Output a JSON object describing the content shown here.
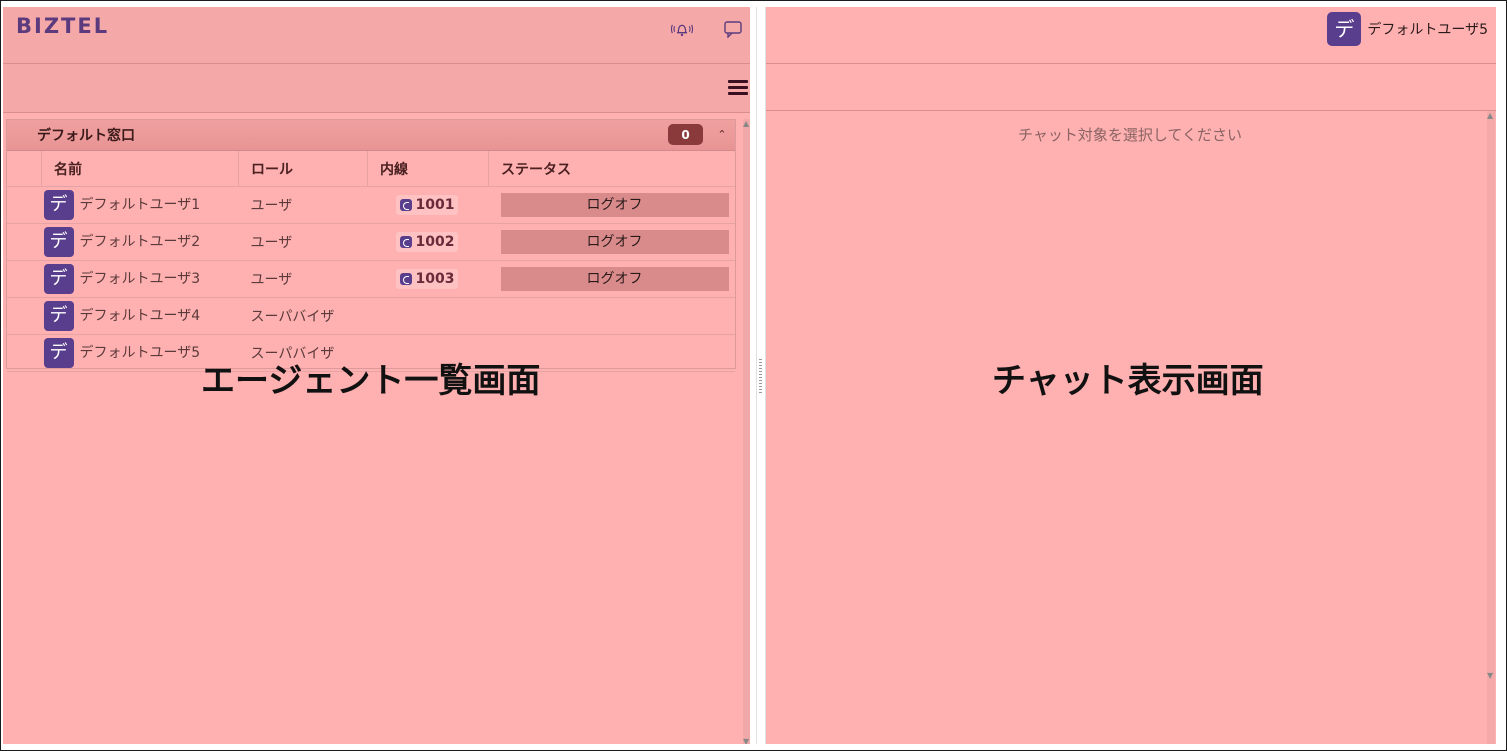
{
  "header": {
    "logo": "BIZTEL",
    "bell_icon": "bell-icon",
    "chat_icon": "chat-bubble-icon",
    "menu_icon": "hamburger-menu-icon"
  },
  "group": {
    "title": "デフォルト窓口",
    "count": "0",
    "collapse_icon": "double-chevron-up-icon",
    "columns": {
      "name": "名前",
      "role": "ロール",
      "extension": "内線",
      "status": "ステータス"
    },
    "rows": [
      {
        "avatar": "デ",
        "name": "デフォルトユーザ1",
        "role": "ユーザ",
        "extension": "1001",
        "status": "ログオフ"
      },
      {
        "avatar": "デ",
        "name": "デフォルトユーザ2",
        "role": "ユーザ",
        "extension": "1002",
        "status": "ログオフ"
      },
      {
        "avatar": "デ",
        "name": "デフォルトユーザ3",
        "role": "ユーザ",
        "extension": "1003",
        "status": "ログオフ"
      },
      {
        "avatar": "デ",
        "name": "デフォルトユーザ4",
        "role": "スーパバイザ",
        "extension": "",
        "status": ""
      },
      {
        "avatar": "デ",
        "name": "デフォルトユーザ5",
        "role": "スーパバイザ",
        "extension": "",
        "status": ""
      }
    ]
  },
  "overlay": {
    "left": "エージェント一覧画面",
    "right": "チャット表示画面"
  },
  "right": {
    "user_avatar": "デ",
    "user_name": "デフォルトユーザ5",
    "placeholder": "チャット対象を選択してください"
  },
  "colors": {
    "pane_bg": "#ffb0b0",
    "avatar": "#5a3e8e",
    "badge": "#8a3a3a",
    "status_bg": "#d98b8b",
    "logo": "#5b3b7e"
  }
}
